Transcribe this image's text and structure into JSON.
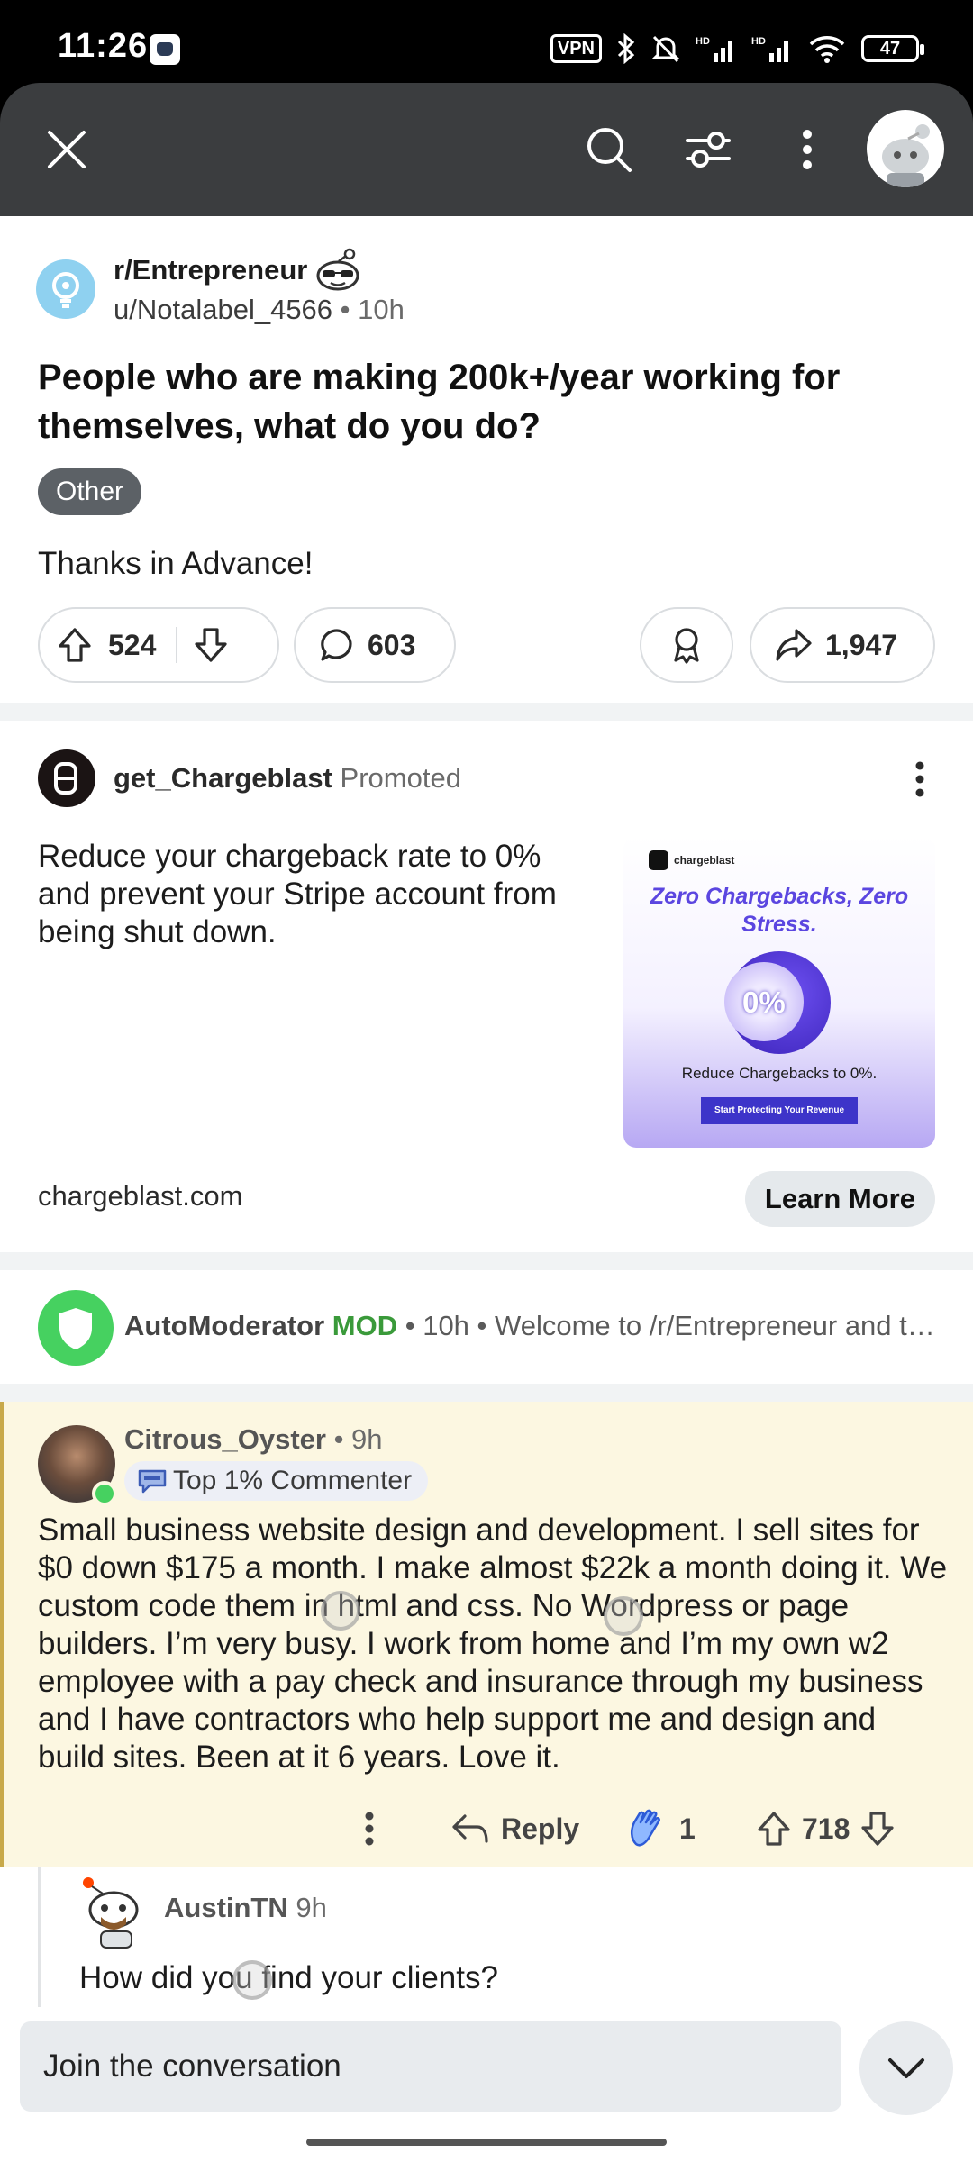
{
  "status_bar": {
    "time": "11:26",
    "vpn": "VPN",
    "battery": "47"
  },
  "post": {
    "subreddit": "r/Entrepreneur",
    "author": "u/Notalabel_4566",
    "age": "• 10h",
    "title": "People who are making 200k+/year working for themselves, what do you do?",
    "flair": "Other",
    "body": "Thanks in Advance!",
    "upvotes": "524",
    "comments": "603",
    "shares": "1,947"
  },
  "ad": {
    "advertiser": "get_Chargeblast",
    "promoted": "Promoted",
    "text": "Reduce your chargeback rate to 0% and prevent your Stripe account from being shut down.",
    "image_brand": "chargeblast",
    "image_headline": "Zero Chargebacks, Zero Stress.",
    "image_percent": "0%",
    "image_caption": "Reduce Chargebacks to 0%.",
    "image_cta": "Start Protecting Your Revenue",
    "domain": "chargeblast.com",
    "cta": "Learn More"
  },
  "automod": {
    "name": "AutoModerator",
    "mod": "MOD",
    "meta": "• 10h • Welcome to /r/Entrepreneur and th..."
  },
  "comment": {
    "author": "Citrous_Oyster",
    "age": "• 9h",
    "badge": "Top 1% Commenter",
    "body": "Small business website design and development. I sell sites for $0 down $175 a month. I make almost $22k a month doing it. We custom code them in html and css. No Wordpress or page builders. I’m very busy. I work from home and I’m my own w2 employee with a pay check and insurance through my business and I have contractors who help support me and design and build sites. Been at it 6 years. Love it.",
    "reply_label": "Reply",
    "award_count": "1",
    "score": "718"
  },
  "reply": {
    "author": "AustinTN",
    "age": "9h",
    "body": "How did you find your clients?"
  },
  "composer": {
    "placeholder": "Join the conversation"
  },
  "colors": {
    "appbar": "#3b3d3f",
    "flair": "#5c6166",
    "comment_highlight": "#fcf7e1",
    "mod_green": "#3a9a3a",
    "online": "#46d160"
  }
}
